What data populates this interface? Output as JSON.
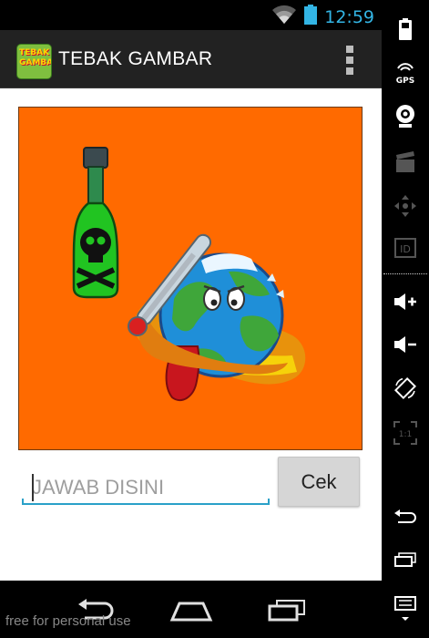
{
  "status_bar": {
    "time": "12:59",
    "icons": [
      "wifi-icon",
      "battery-icon"
    ]
  },
  "action_bar": {
    "app_icon_text": "TEBAK GAMBAR",
    "title": "TEBAK GAMBAR",
    "menu_icon": "overflow-menu-icon"
  },
  "quiz": {
    "picture_description_icon": "global-warming-picture",
    "answer_placeholder": "JAWAB DISINI",
    "answer_value": "",
    "submit_label": "Cek"
  },
  "nav_bar": {
    "buttons": [
      "back-icon",
      "home-icon",
      "recent-apps-icon"
    ]
  },
  "emulator_panel": {
    "buttons": [
      "battery-icon",
      "gps-icon",
      "camera-icon",
      "clapper-icon",
      "dpad-icon",
      "id-icon",
      "volume-up-icon",
      "volume-down-icon",
      "rotate-icon",
      "scale-icon",
      "back-icon",
      "recent-apps-icon",
      "menu-icon"
    ],
    "gps_label": "GPS",
    "id_label": "ID",
    "scale_label": "1:1"
  },
  "watermark": "free for personal use",
  "colors": {
    "picture_background": "#ff6a00",
    "accent": "#33b5e5",
    "input_underline": "#2aa0c8"
  }
}
